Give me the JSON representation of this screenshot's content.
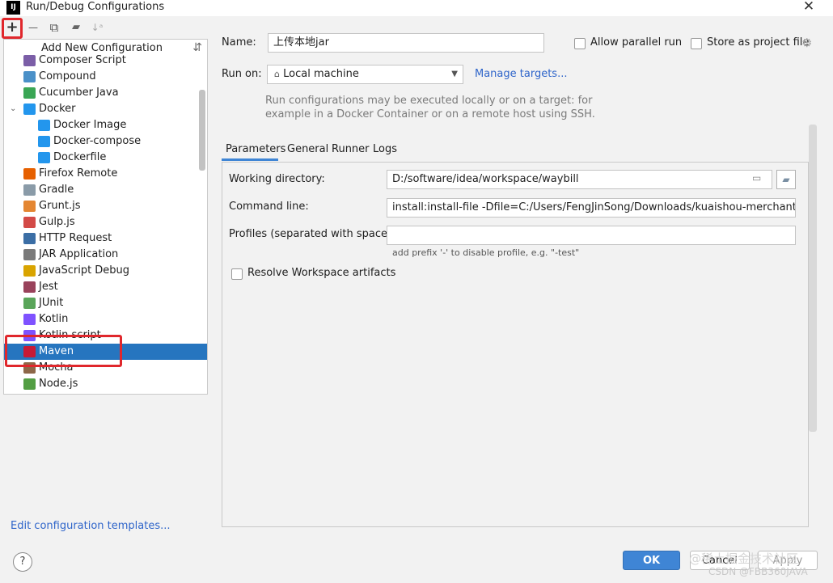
{
  "window": {
    "title": "Run/Debug Configurations",
    "app_icon": "IJ"
  },
  "toolbar": {
    "add": "+",
    "remove": "—",
    "copy": "⧉",
    "folder": "▰",
    "sort": "↓ᵃ"
  },
  "tree": {
    "header": "Add New Configuration",
    "items": [
      {
        "label": "Composer Script",
        "icon": "composer-icon",
        "color": "#7b5ea7"
      },
      {
        "label": "Compound",
        "icon": "compound-icon",
        "color": "#4a90c8"
      },
      {
        "label": "Cucumber Java",
        "icon": "cucumber-icon",
        "color": "#3aa655"
      },
      {
        "label": "Docker",
        "icon": "docker-icon",
        "color": "#2396ed"
      },
      {
        "label": "Docker Image",
        "icon": "docker-icon",
        "color": "#2396ed"
      },
      {
        "label": "Docker-compose",
        "icon": "docker-icon",
        "color": "#2396ed"
      },
      {
        "label": "Dockerfile",
        "icon": "docker-icon",
        "color": "#2396ed"
      },
      {
        "label": "Firefox Remote",
        "icon": "firefox-icon",
        "color": "#e66000"
      },
      {
        "label": "Gradle",
        "icon": "gradle-icon",
        "color": "#8a9ba8"
      },
      {
        "label": "Grunt.js",
        "icon": "grunt-icon",
        "color": "#e48632"
      },
      {
        "label": "Gulp.js",
        "icon": "gulp-icon",
        "color": "#d34a47"
      },
      {
        "label": "HTTP Request",
        "icon": "api-icon",
        "color": "#3b6ea5"
      },
      {
        "label": "JAR Application",
        "icon": "jar-icon",
        "color": "#7a7a7a"
      },
      {
        "label": "JavaScript Debug",
        "icon": "js-debug-icon",
        "color": "#d9a400"
      },
      {
        "label": "Jest",
        "icon": "jest-icon",
        "color": "#99425b"
      },
      {
        "label": "JUnit",
        "icon": "junit-icon",
        "color": "#5aa55a"
      },
      {
        "label": "Kotlin",
        "icon": "kotlin-icon",
        "color": "#7f52ff"
      },
      {
        "label": "Kotlin script",
        "icon": "kotlin-icon",
        "color": "#7f52ff"
      },
      {
        "label": "Maven",
        "icon": "maven-icon",
        "color": "#c71a36"
      },
      {
        "label": "Mocha",
        "icon": "mocha-icon",
        "color": "#8d6748"
      },
      {
        "label": "Node.js",
        "icon": "nodejs-icon",
        "color": "#539e43"
      }
    ],
    "selected": "Maven"
  },
  "footer": {
    "edit_templates": "Edit configuration templates...",
    "help": "?"
  },
  "form": {
    "name_label": "Name:",
    "name_value": "上传本地jar",
    "allow_parallel": "Allow parallel run",
    "store_as_project": "Store as project file",
    "run_on_label": "Run on:",
    "run_on_value": "Local machine",
    "manage_targets": "Manage targets...",
    "hint_line1": "Run configurations may be executed locally or on a target: for",
    "hint_line2": "example in a Docker Container or on a remote host using SSH."
  },
  "tabs": [
    "Parameters",
    "General",
    "Runner",
    "Logs"
  ],
  "parameters": {
    "working_dir_label": "Working directory:",
    "working_dir_value": "D:/software/idea/workspace/waybill",
    "command_line_label": "Command line:",
    "command_line_value": "install:install-file -Dfile=C:/Users/FengJinSong/Downloads/kuaishou-merchant-open-sdk",
    "profiles_label": "Profiles (separated with space):",
    "profiles_value": "",
    "profiles_hint": "add prefix '-' to disable profile, e.g. \"-test\"",
    "resolve_workspace": "Resolve Workspace artifacts"
  },
  "buttons": {
    "ok": "OK",
    "cancel": "Cancel",
    "apply": "Apply"
  },
  "watermarks": {
    "line1": "@稀土掘金技术社区",
    "line2": "CSDN @FBB360JAVA"
  },
  "colors": {
    "selection": "#2675bf",
    "accent": "#3f85d5",
    "link": "#2f65ca",
    "highlight": "#e0272c"
  }
}
